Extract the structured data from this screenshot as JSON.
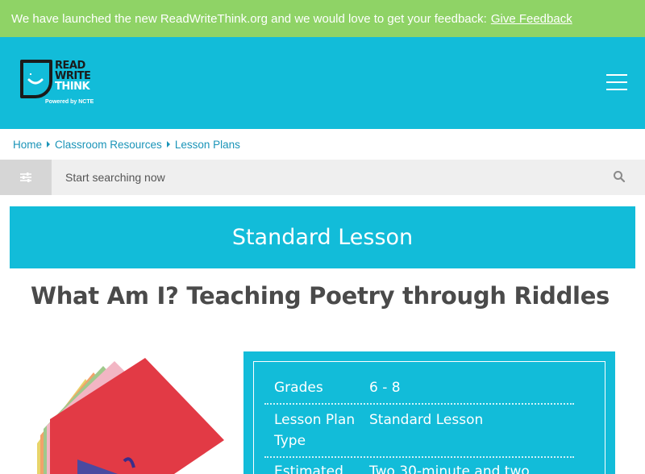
{
  "banner": {
    "text": "We have launched the new ReadWriteThink.org and we would love to get your feedback:",
    "link": "Give Feedback"
  },
  "logo": {
    "line1": "READ",
    "line2": "WRITE",
    "line3": "THINK",
    "tagline": "Powered by NCTE"
  },
  "breadcrumb": [
    "Home",
    "Classroom Resources",
    "Lesson Plans"
  ],
  "search": {
    "placeholder": "Start searching now"
  },
  "lesson_type_banner": "Standard Lesson",
  "page_title": "What Am I? Teaching Poetry through Riddles",
  "details": {
    "grades_label": "Grades",
    "grades_value": "6 - 8",
    "plan_type_label": "Lesson Plan Type",
    "plan_type_value": "Standard Lesson",
    "time_label": "Estimated",
    "time_value": "Two 30-minute and two"
  },
  "colors": {
    "brand_cyan": "#12bcd9",
    "banner_green": "#8fd366",
    "link_blue": "#1a94b8",
    "title_gray": "#4a4a4a"
  },
  "icons": [
    "smile-page-icon",
    "hamburger-menu-icon",
    "breadcrumb-caret-icon",
    "filter-sliders-icon",
    "search-icon"
  ]
}
